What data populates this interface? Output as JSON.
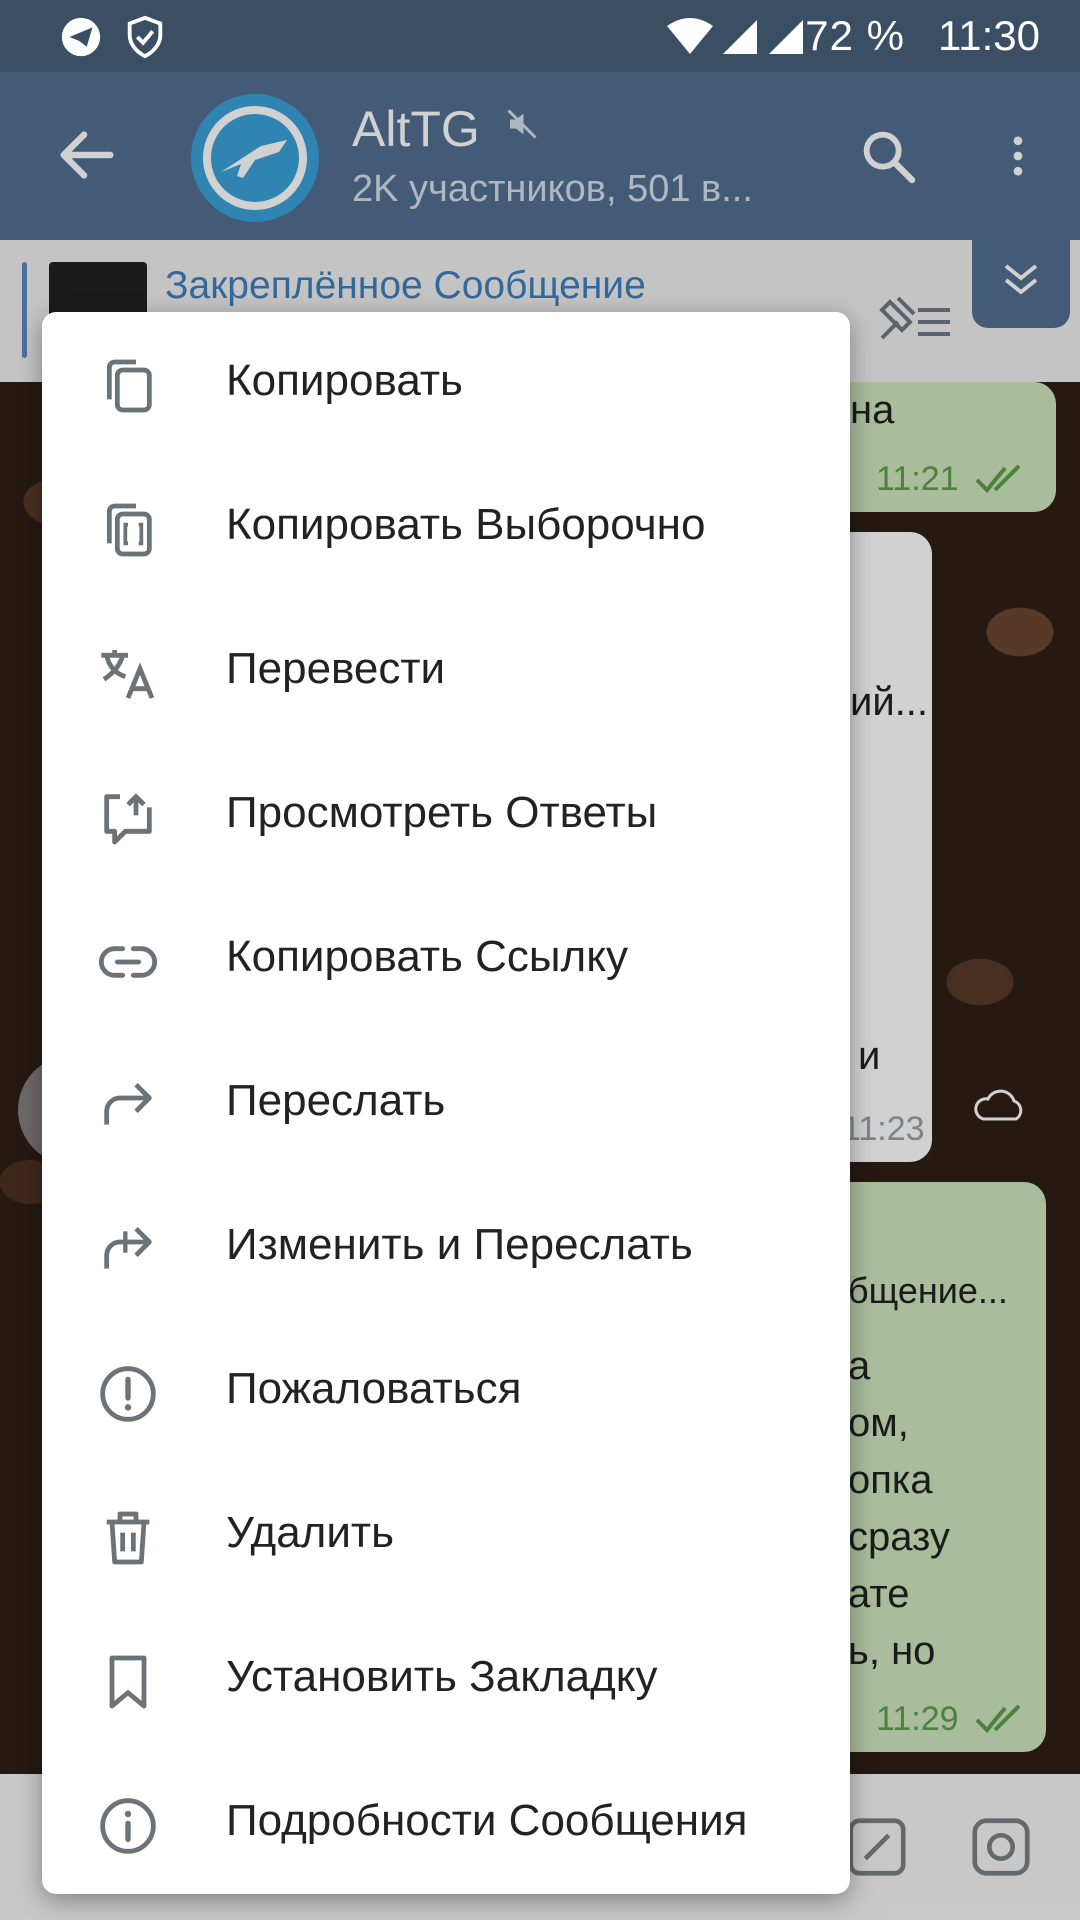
{
  "status_bar": {
    "battery": "72 %",
    "time": "11:30"
  },
  "header": {
    "title": "AltTG",
    "subtitle": "2K участников, 501 в..."
  },
  "pinned": {
    "title": "Закреплённое Сообщение"
  },
  "chat": {
    "b1_text": "на",
    "b1_time": "11:21",
    "b2_text1": "ий...",
    "b2_text2": "и",
    "b2_time": "11:23",
    "b3_text1": "бщение...",
    "b3_lines": [
      "а",
      "ом,",
      "опка",
      "сразу",
      "ате",
      "ь, но"
    ],
    "b3_time": "11:29"
  },
  "menu": {
    "items": [
      {
        "label": "Копировать",
        "icon": "copy-icon"
      },
      {
        "label": "Копировать Выборочно",
        "icon": "copy-selection-icon"
      },
      {
        "label": "Перевести",
        "icon": "translate-icon"
      },
      {
        "label": "Просмотреть Ответы",
        "icon": "view-replies-icon"
      },
      {
        "label": "Копировать Ссылку",
        "icon": "link-icon"
      },
      {
        "label": "Переслать",
        "icon": "forward-icon"
      },
      {
        "label": "Изменить и Переслать",
        "icon": "edit-forward-icon"
      },
      {
        "label": "Пожаловаться",
        "icon": "report-icon"
      },
      {
        "label": "Удалить",
        "icon": "trash-icon"
      },
      {
        "label": "Установить Закладку",
        "icon": "bookmark-icon"
      },
      {
        "label": "Подробности Сообщения",
        "icon": "info-icon"
      }
    ]
  }
}
